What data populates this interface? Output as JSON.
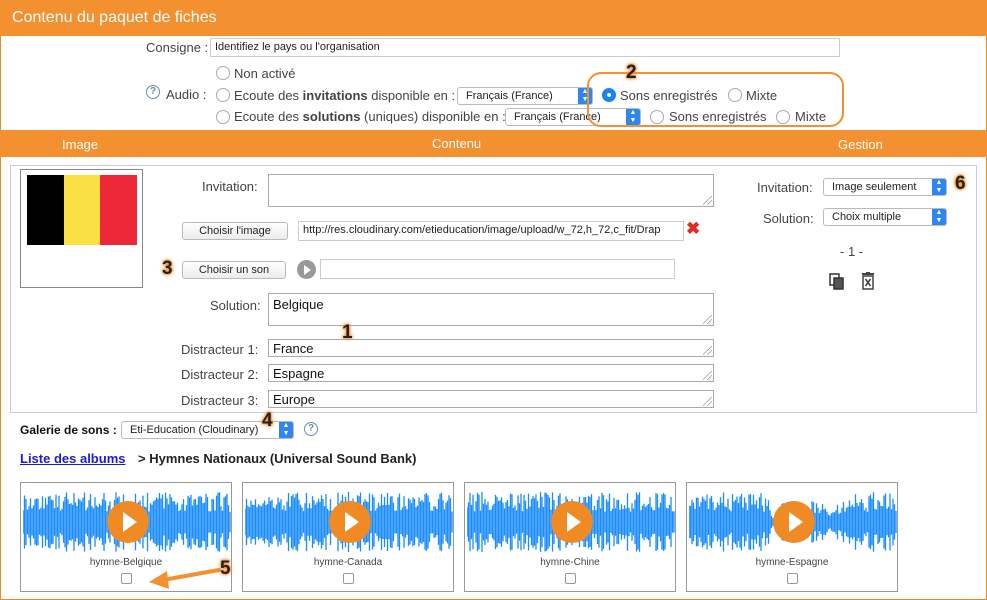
{
  "header": {
    "title": "Contenu du paquet de fiches"
  },
  "consigne": {
    "label": "Consigne :",
    "value": "Identifiez le pays ou l'organisation"
  },
  "audio": {
    "label": "Audio :",
    "none": "Non activé",
    "invitations_pre": "Ecoute des ",
    "invitations_bold": "invitations",
    "invitations_post": " disponible en :",
    "invitations_lang": "Français (France)",
    "solutions_pre": "Ecoute des ",
    "solutions_bold": "solutions",
    "solutions_post": " (uniques) disponible en :",
    "solutions_lang": "Français (France)",
    "sons_enregistres": "Sons enregistrés",
    "mixte": "Mixte"
  },
  "columns": {
    "image": "Image",
    "contenu": "Contenu",
    "gestion": "Gestion"
  },
  "card": {
    "invitation_label": "Invitation:",
    "invitation_value": "",
    "choose_image": "Choisir l'image",
    "image_url": "http://res.cloudinary.com/etieducation/image/upload/w_72,h_72,c_fit/Drap",
    "choose_sound": "Choisir un son",
    "sound_value": "",
    "solution_label": "Solution:",
    "solution_value": "Belgique",
    "d1_label": "Distracteur 1:",
    "d1_value": "France",
    "d2_label": "Distracteur 2:",
    "d2_value": "Espagne",
    "d3_label": "Distracteur 3:",
    "d3_value": "Europe"
  },
  "gestion": {
    "invitation_label": "Invitation:",
    "invitation_select": "Image seulement",
    "solution_label": "Solution:",
    "solution_select": "Choix multiple",
    "page": "- 1 -"
  },
  "gallery": {
    "label": "Galerie de sons :",
    "source": "Eti-Education (Cloudinary)",
    "albums_link": "Liste des albums",
    "breadcrumb": "> Hymnes Nationaux (Universal Sound Bank)",
    "items": [
      "hymne-Belgique",
      "hymne-Canada",
      "hymne-Chine",
      "hymne-Espagne"
    ]
  },
  "callouts": [
    "1",
    "2",
    "3",
    "4",
    "5",
    "6"
  ],
  "colors": {
    "orange": "#f39030",
    "blue_wave": "#1a8cff",
    "flag": [
      "#000000",
      "#fae042",
      "#ed2939"
    ]
  }
}
